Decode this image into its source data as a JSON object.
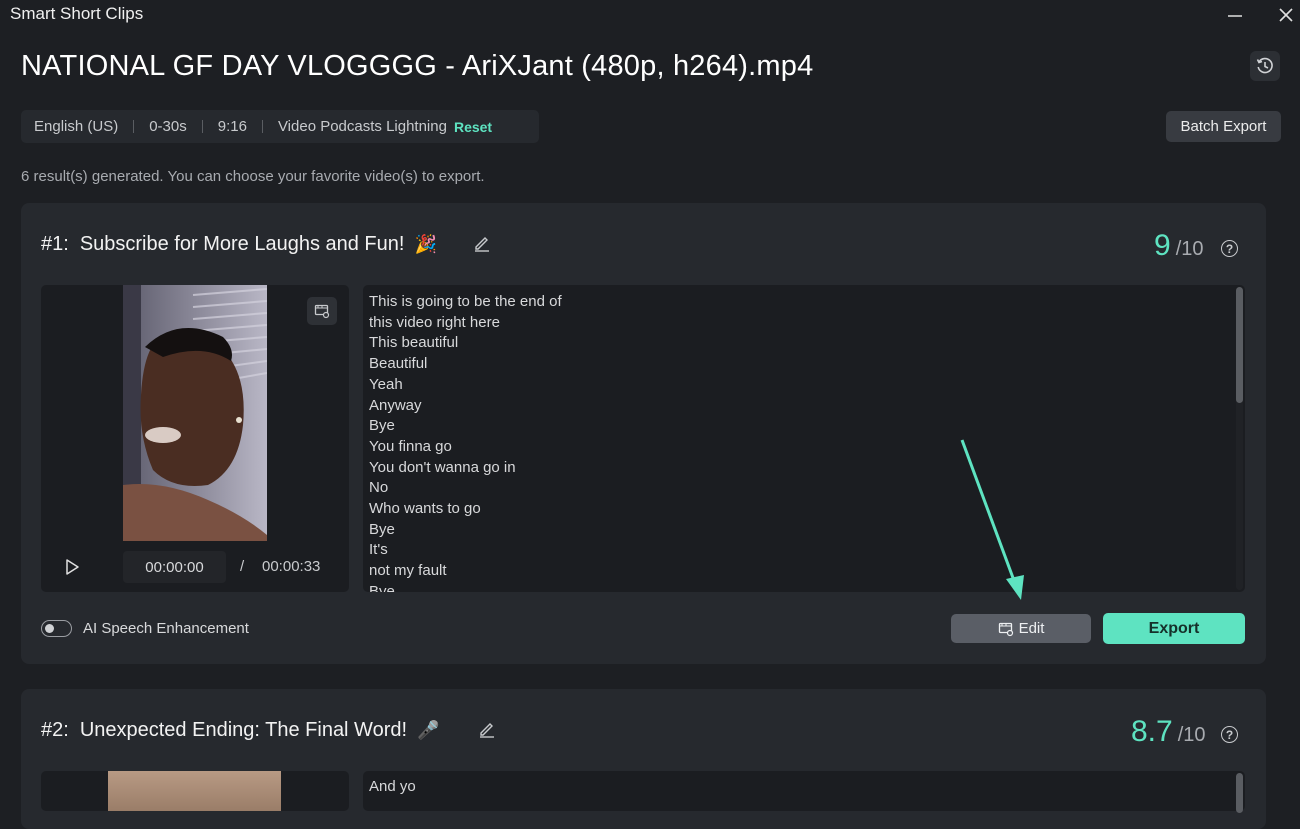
{
  "window": {
    "title": "Smart Short Clips"
  },
  "header": {
    "file_title": "NATIONAL GF DAY VLOGGGG - AriXJant (480p, h264).mp4",
    "settings": [
      "English (US)",
      "0-30s",
      "9:16",
      "Video Podcasts Lightning"
    ],
    "reset_label": "Reset",
    "batch_export_label": "Batch Export",
    "result_count": "6 result(s) generated. You can choose your favorite video(s) to export."
  },
  "clips": [
    {
      "number": "#1:",
      "title": "Subscribe for More Laughs and Fun!",
      "emoji": "🎉",
      "score": "9",
      "score_max": "/10",
      "time_current": "00:00:00",
      "time_sep": "/",
      "time_total": "00:00:33",
      "transcript": [
        "This is going to be the end of",
        "this video right here",
        "This beautiful",
        "Beautiful",
        "Yeah",
        "Anyway",
        "Bye",
        "You finna go",
        "You don't wanna go in",
        "No",
        "Who wants to go",
        "Bye",
        "It's",
        "not my fault",
        "Bye"
      ],
      "ai_speech_label": "AI Speech Enhancement",
      "ai_speech_enabled": false,
      "edit_label": "Edit",
      "export_label": "Export"
    },
    {
      "number": "#2:",
      "title": "Unexpected Ending: The Final Word!",
      "emoji": "🎤",
      "score": "8.7",
      "score_max": "/10",
      "transcript": [
        "And yo"
      ]
    }
  ],
  "colors": {
    "accent": "#5ee3c1",
    "background": "#1d1f23",
    "card": "#26292e"
  }
}
